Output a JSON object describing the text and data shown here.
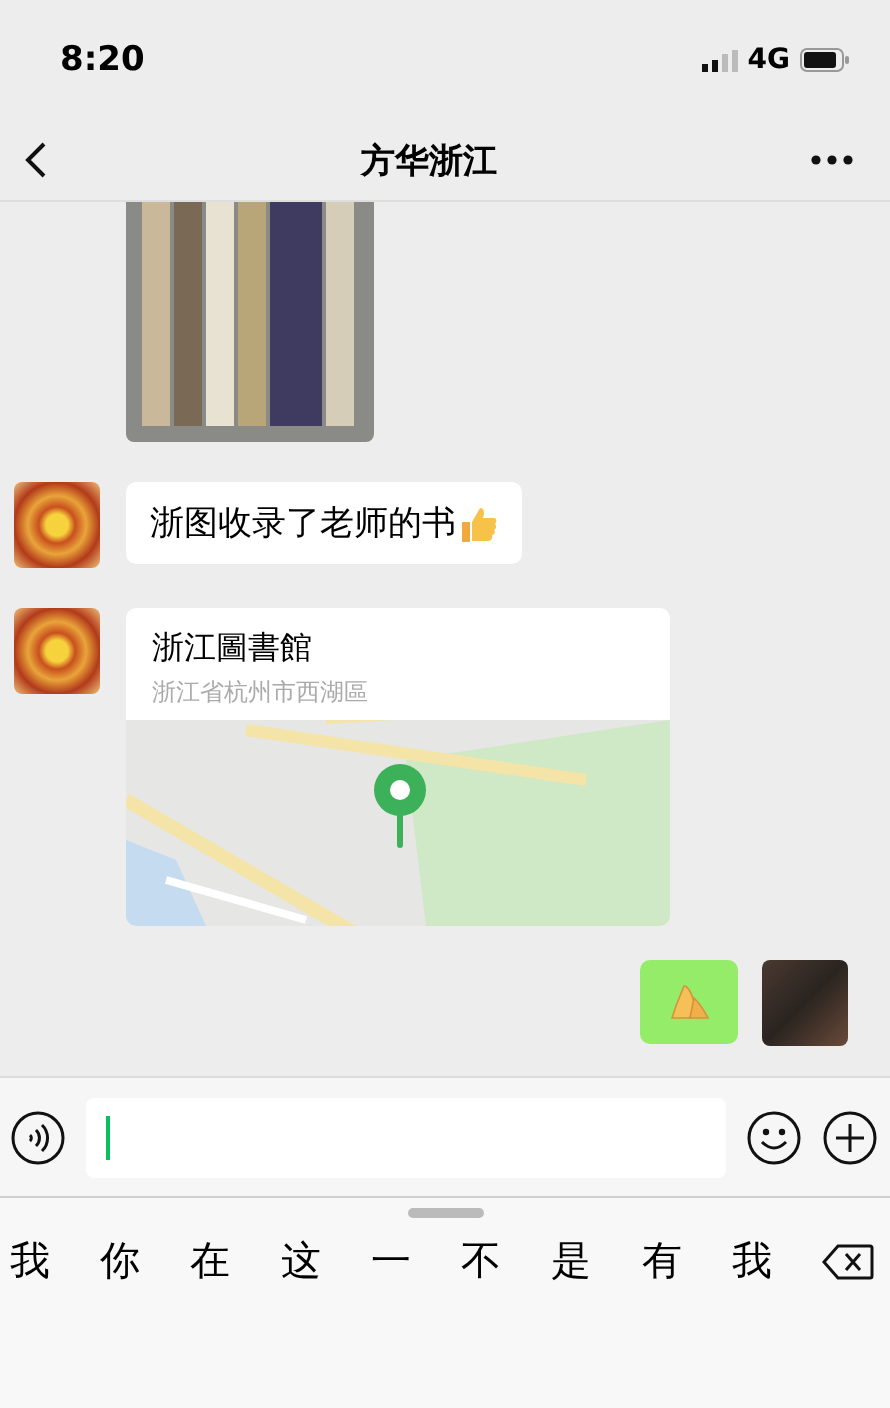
{
  "status_bar": {
    "time": "8:20",
    "network": "4G"
  },
  "nav": {
    "title": "方华浙江"
  },
  "messages": [
    {
      "kind": "image",
      "outgoing": false
    },
    {
      "kind": "text",
      "outgoing": false,
      "text": "浙图收录了老师的书"
    },
    {
      "kind": "location",
      "outgoing": false,
      "name": "浙江圖書館",
      "address": "浙江省杭州市西湖區"
    },
    {
      "kind": "sticker",
      "outgoing": true
    }
  ],
  "keyboard": {
    "candidates": [
      "我",
      "你",
      "在",
      "这",
      "一",
      "不",
      "是",
      "有",
      "我"
    ]
  }
}
